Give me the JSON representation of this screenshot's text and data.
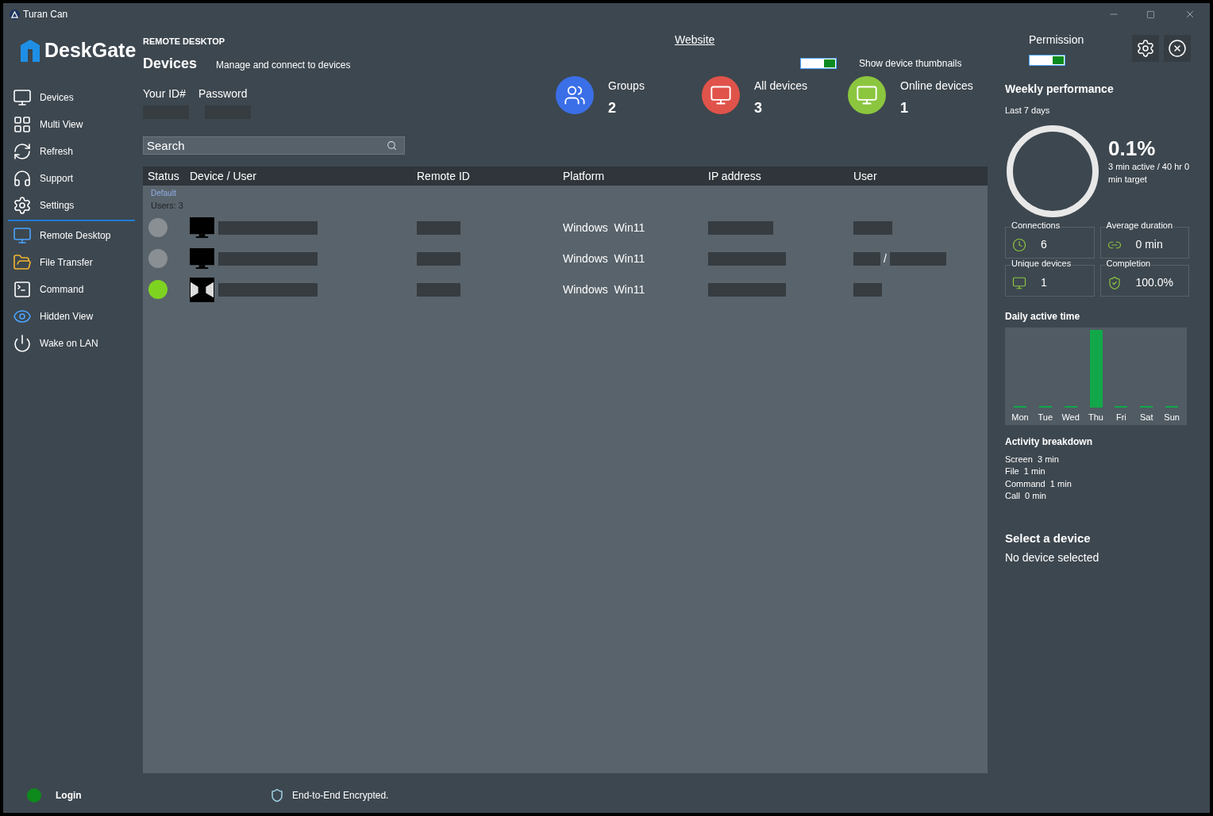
{
  "window": {
    "title": "Turan Can"
  },
  "brand": {
    "name": "DeskGate"
  },
  "header": {
    "section": "REMOTE DESKTOP",
    "title": "Devices",
    "subtitle": "Manage and connect to devices",
    "link": "Website",
    "thumbnails_toggle": {
      "label": "Show device thumbnails",
      "on": true
    },
    "permission": {
      "label": "Permission",
      "on": true
    }
  },
  "sidebar": {
    "main_items": [
      {
        "label": "Devices"
      },
      {
        "label": "Multi View"
      },
      {
        "label": "Refresh"
      },
      {
        "label": "Support"
      },
      {
        "label": "Settings"
      }
    ],
    "tool_items": [
      {
        "label": "Remote Desktop"
      },
      {
        "label": "File Transfer"
      },
      {
        "label": "Command"
      },
      {
        "label": "Hidden View"
      },
      {
        "label": "Wake on LAN"
      }
    ]
  },
  "credentials": {
    "id_label": "Your ID#",
    "password_label": "Password"
  },
  "stats": [
    {
      "label": "Groups",
      "value": "2",
      "color": "#3b6fe8"
    },
    {
      "label": "All devices",
      "value": "3",
      "color": "#e0534a"
    },
    {
      "label": "Online devices",
      "value": "1",
      "color": "#8cc63f"
    }
  ],
  "search": {
    "placeholder": "Search"
  },
  "table": {
    "columns": [
      "Status",
      "Device / User",
      "Remote ID",
      "Platform",
      "IP address",
      "User"
    ],
    "group": {
      "name": "Default",
      "count": "Users: 3"
    },
    "rows": [
      {
        "online": false,
        "kind": "monitor",
        "platform": "Windows  Win11"
      },
      {
        "online": false,
        "kind": "monitor",
        "platform": "Windows  Win11",
        "user_separator": "/"
      },
      {
        "online": true,
        "kind": "thumbnail",
        "platform": "Windows  Win11"
      }
    ]
  },
  "performance": {
    "title": "Weekly performance",
    "period": "Last 7 days",
    "percent": "0.1%",
    "detail": "3 min active / 40 hr 0 min target",
    "tiles": [
      {
        "label": "Connections",
        "value": "6"
      },
      {
        "label": "Average duration",
        "value": "0 min"
      },
      {
        "label": "Unique devices",
        "value": "1"
      },
      {
        "label": "Completion",
        "value": "100.0%"
      }
    ],
    "daily_title": "Daily active time",
    "days": [
      {
        "label": "Mon",
        "kind": "flat"
      },
      {
        "label": "Tue",
        "kind": "flat"
      },
      {
        "label": "Wed",
        "kind": "flat"
      },
      {
        "label": "Thu",
        "kind": "tall"
      },
      {
        "label": "Fri",
        "kind": "flat"
      },
      {
        "label": "Sat",
        "kind": "flat"
      },
      {
        "label": "Sun",
        "kind": "flat"
      }
    ],
    "breakdown_title": "Activity breakdown",
    "breakdown": [
      "Screen  3 min",
      "File  1 min",
      "Command  1 min",
      "Call  0 min"
    ],
    "selection_title": "Select a device",
    "selection_text": "No device selected"
  },
  "status_bar": {
    "login": "Login",
    "encryption": "End-to-End Encrypted."
  }
}
